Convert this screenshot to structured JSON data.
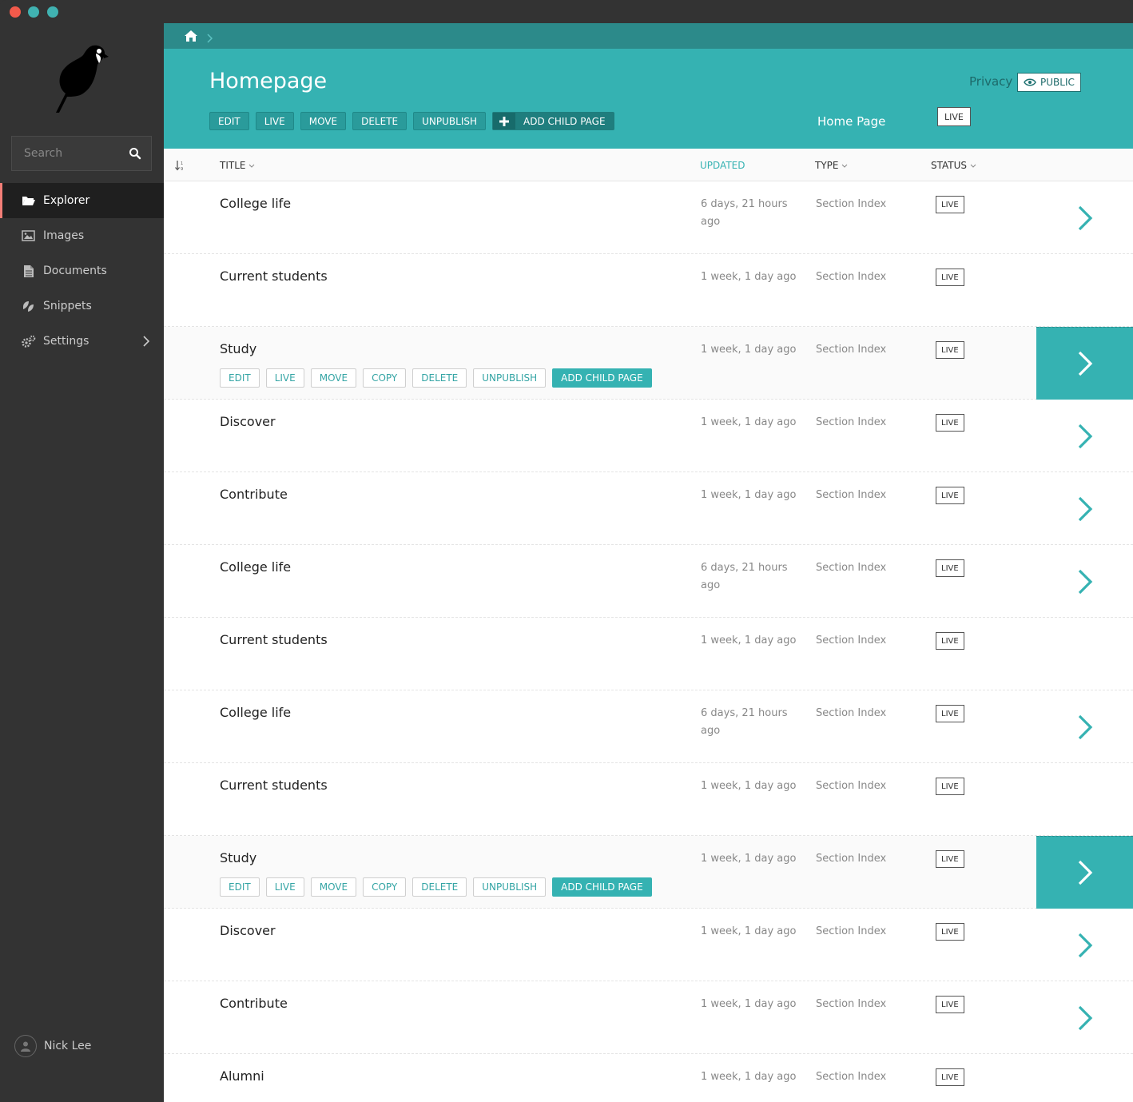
{
  "sidebar": {
    "search_placeholder": "Search",
    "items": [
      {
        "label": "Explorer",
        "icon": "folder-open-icon",
        "active": true
      },
      {
        "label": "Images",
        "icon": "image-icon"
      },
      {
        "label": "Documents",
        "icon": "document-icon"
      },
      {
        "label": "Snippets",
        "icon": "snippets-icon"
      },
      {
        "label": "Settings",
        "icon": "cogs-icon",
        "has_submenu": true
      }
    ],
    "user": "Nick Lee"
  },
  "header": {
    "title": "Homepage",
    "buttons": [
      "EDIT",
      "LIVE",
      "MOVE",
      "DELETE",
      "UNPUBLISH"
    ],
    "add_child": "ADD CHILD PAGE",
    "privacy_label": "Privacy",
    "privacy_value": "PUBLIC",
    "page_type": "Home Page",
    "status": "LIVE"
  },
  "columns": {
    "title": "TITLE",
    "updated": "UPDATED",
    "type": "TYPE",
    "status": "STATUS"
  },
  "row_actions": [
    "EDIT",
    "LIVE",
    "MOVE",
    "COPY",
    "DELETE",
    "UNPUBLISH",
    "ADD CHILD PAGE"
  ],
  "rows": [
    {
      "title": "College life",
      "updated": "6 days, 21 hours ago",
      "type": "Section Index",
      "status": "LIVE",
      "arrow": true
    },
    {
      "title": "Current students",
      "updated": "1 week, 1 day ago",
      "type": "Section Index",
      "status": "LIVE",
      "arrow": false
    },
    {
      "title": "Study",
      "updated": "1 week, 1 day ago",
      "type": "Section Index",
      "status": "LIVE",
      "arrow": true,
      "highlighted": true
    },
    {
      "title": "Discover",
      "updated": "1 week, 1 day ago",
      "type": "Section Index",
      "status": "LIVE",
      "arrow": true
    },
    {
      "title": "Contribute",
      "updated": "1 week, 1 day ago",
      "type": "Section Index",
      "status": "LIVE",
      "arrow": true
    },
    {
      "title": "College life",
      "updated": "6 days, 21 hours ago",
      "type": "Section Index",
      "status": "LIVE",
      "arrow": true
    },
    {
      "title": "Current students",
      "updated": "1 week, 1 day ago",
      "type": "Section Index",
      "status": "LIVE",
      "arrow": false
    },
    {
      "title": "College life",
      "updated": "6 days, 21 hours ago",
      "type": "Section Index",
      "status": "LIVE",
      "arrow": true
    },
    {
      "title": "Current students",
      "updated": "1 week, 1 day ago",
      "type": "Section Index",
      "status": "LIVE",
      "arrow": false
    },
    {
      "title": "Study",
      "updated": "1 week, 1 day ago",
      "type": "Section Index",
      "status": "LIVE",
      "arrow": true,
      "highlighted": true
    },
    {
      "title": "Discover",
      "updated": "1 week, 1 day ago",
      "type": "Section Index",
      "status": "LIVE",
      "arrow": true
    },
    {
      "title": "Contribute",
      "updated": "1 week, 1 day ago",
      "type": "Section Index",
      "status": "LIVE",
      "arrow": true
    },
    {
      "title": "Alumni",
      "updated": "1 week, 1 day ago",
      "type": "Section Index",
      "status": "LIVE",
      "arrow": false
    }
  ],
  "colors": {
    "teal": "#35b2b2",
    "dark_teal": "#2c8a8a",
    "sidebar": "#333333",
    "accent_red": "#f37e77"
  }
}
